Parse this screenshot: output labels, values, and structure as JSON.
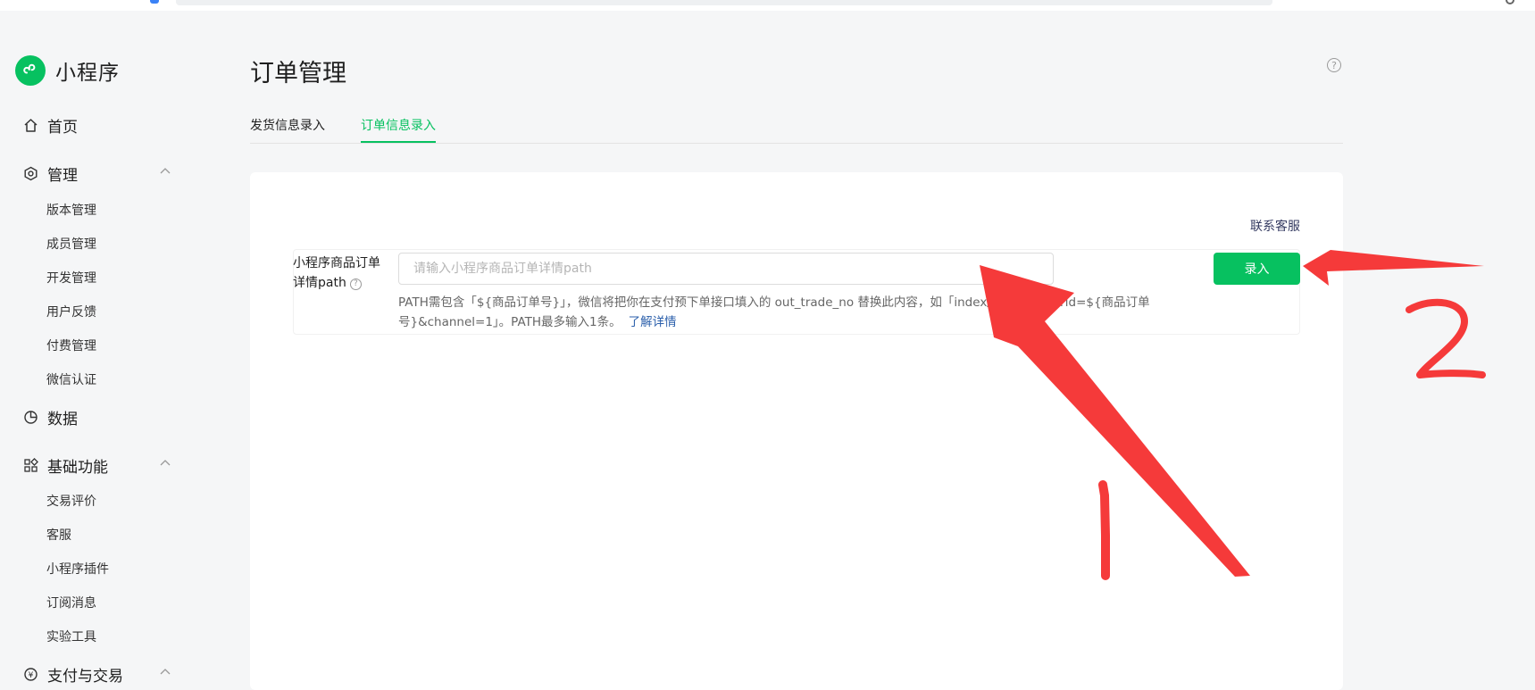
{
  "app": {
    "title": "小程序"
  },
  "sidebar": {
    "home": {
      "label": "首页",
      "icon": "home-icon"
    },
    "manage": {
      "label": "管理",
      "icon": "settings-hexagon-icon",
      "items": [
        "版本管理",
        "成员管理",
        "开发管理",
        "用户反馈",
        "付费管理",
        "微信认证"
      ]
    },
    "data": {
      "label": "数据",
      "icon": "pie-chart-icon"
    },
    "basic": {
      "label": "基础功能",
      "icon": "grid-icon",
      "items": [
        "交易评价",
        "客服",
        "小程序插件",
        "订阅消息",
        "实验工具"
      ]
    },
    "payment": {
      "label": "支付与交易",
      "icon": "yen-icon"
    }
  },
  "main": {
    "title": "订单管理",
    "tabs": [
      {
        "label": "发货信息录入",
        "active": false
      },
      {
        "label": "订单信息录入",
        "active": true
      }
    ],
    "contact_link": "联系客服",
    "form": {
      "label_line1": "小程序商品订单",
      "label_line2": "详情path",
      "placeholder": "请输入小程序商品订单详情path",
      "value": "",
      "hint_line1": "PATH需包含「${商品订单号}」，微信将把你在支付预下单接口填入的 out_trade_no 替换此内容，如「index/orderDetail?id=${商品订单",
      "hint_line2": "号}&channel=1」。PATH最多输入1条。",
      "hint_link": "了解详情",
      "submit_label": "录入"
    }
  },
  "annotations": {
    "color": "#f53a3a",
    "label_1": "1",
    "label_2": "2"
  },
  "colors": {
    "accent": "#07c160",
    "link": "#2b5fab"
  }
}
